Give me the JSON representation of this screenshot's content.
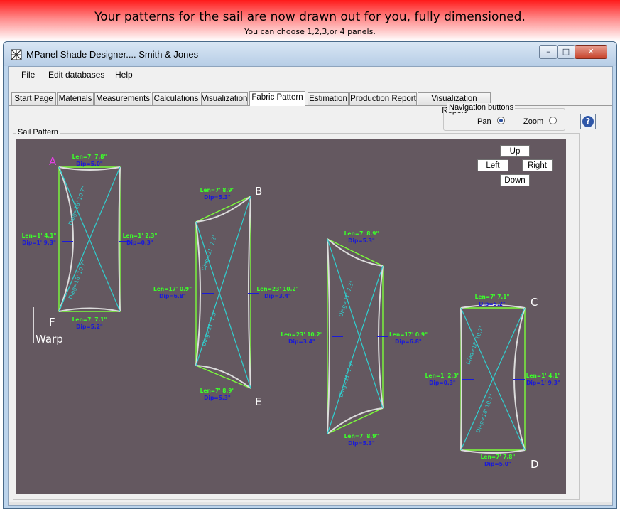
{
  "banner": {
    "main": "Your patterns for the sail are now drawn out for you, fully dimensioned.",
    "sub": "You can choose 1,2,3,or 4 panels."
  },
  "window": {
    "title": "MPanel Shade Designer.... Smith & Jones",
    "controls": {
      "minimize": "–",
      "maximize": "□",
      "close": "✕"
    }
  },
  "menu": [
    "File",
    "Edit databases",
    "Help"
  ],
  "tabs": [
    {
      "label": "Start Page"
    },
    {
      "label": "Materials"
    },
    {
      "label": "Measurements"
    },
    {
      "label": "Calculations"
    },
    {
      "label": "Visualization"
    },
    {
      "label": "Fabric Pattern",
      "active": true
    },
    {
      "label": "Estimation"
    },
    {
      "label": "Production Report"
    },
    {
      "label": "Visualization Report"
    }
  ],
  "navigation": {
    "legend": "Navigation buttons",
    "pan_label": "Pan",
    "zoom_label": "Zoom",
    "selected": "Pan"
  },
  "help_icon": "?",
  "sail_pattern": {
    "legend": "Sail Pattern",
    "pan_buttons": {
      "up": "Up",
      "left": "Left",
      "right": "Right",
      "down": "Down"
    },
    "warp_label": "Warp",
    "corner_labels": [
      "A",
      "B",
      "C",
      "D",
      "E",
      "F"
    ],
    "colors": {
      "background": "#645860",
      "edge": "#7cff3a",
      "seam": "#dcdcdc",
      "diag": "#2fd0d0",
      "dim_green": "#3cff2a",
      "dim_blue": "#1a1ad8",
      "corner": "#ffffff",
      "marker": "#e040e0"
    },
    "panels": [
      {
        "top": {
          "len": "Len=7' 7.8\"",
          "dip": "Dip=5.0\""
        },
        "bottom": {
          "len": "Len=7' 7.1\"",
          "dip": "Dip=5.2\""
        },
        "left": {
          "len": "Len=1' 4.1\"",
          "dip": "Dip=1' 9.3\""
        },
        "right": {
          "len": "Len=1' 2.3\"",
          "dip": "Dip=0.3\""
        },
        "diag1": "Diag=18' 10.7\"",
        "diag2": "Diag=18' 10.7\""
      },
      {
        "top": {
          "len": "Len=7' 8.9\"",
          "dip": "Dip=5.3\""
        },
        "bottom": {
          "len": "Len=7' 8.9\"",
          "dip": "Dip=5.3\""
        },
        "left": {
          "len": "Len=17' 0.9\"",
          "dip": "Dip=6.8\""
        },
        "right": {
          "len": "Len=23' 10.2\"",
          "dip": "Dip=3.4\""
        },
        "diag1": "Diag=21' 7.3\"",
        "diag2": "Diag=21' 7.3\""
      },
      {
        "top": {
          "len": "Len=7' 8.9\"",
          "dip": "Dip=5.3\""
        },
        "bottom": {
          "len": "Len=7' 8.9\"",
          "dip": "Dip=5.3\""
        },
        "left": {
          "len": "Len=23' 10.2\"",
          "dip": "Dip=3.4\""
        },
        "right": {
          "len": "Len=17' 0.9\"",
          "dip": "Dip=6.8\""
        },
        "diag1": "Diag=21' 7.3\"",
        "diag2": "Diag=21' 7.3\""
      },
      {
        "top": {
          "len": "Len=7' 7.1\"",
          "dip": "Dip=5.2\""
        },
        "bottom": {
          "len": "Len=7' 7.8\"",
          "dip": "Dip=5.0\""
        },
        "left": {
          "len": "Len=1' 2.3\"",
          "dip": "Dip=0.3\""
        },
        "right": {
          "len": "Len=1' 4.1\"",
          "dip": "Dip=1' 9.3\""
        },
        "diag1": "Diag=18' 10.7\"",
        "diag2": "Diag=18' 10.7\""
      }
    ]
  }
}
